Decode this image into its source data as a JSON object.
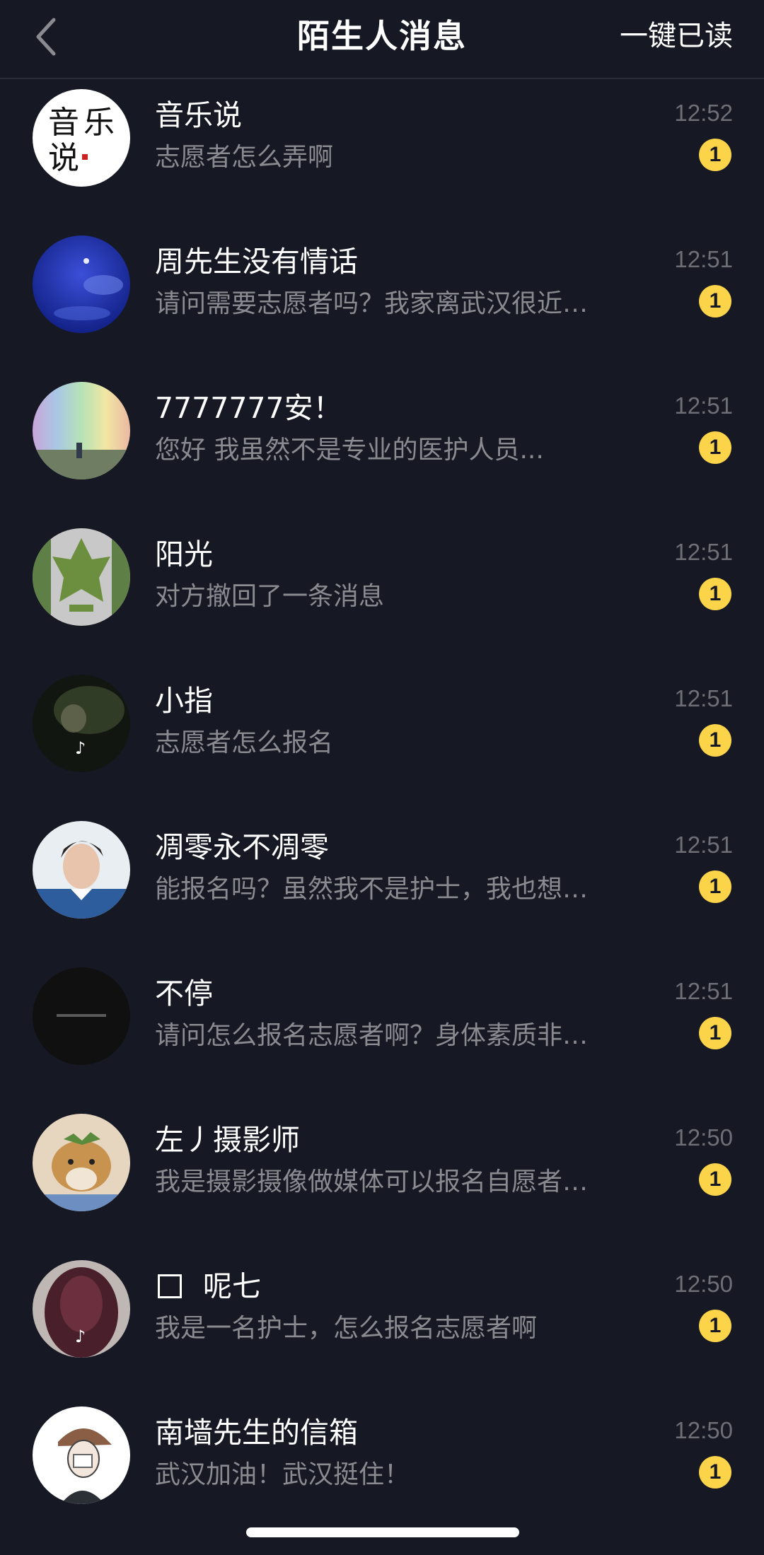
{
  "header": {
    "title": "陌生人消息",
    "mark_all_read": "一键已读",
    "back_icon": "chevron-left-icon"
  },
  "colors": {
    "background": "#161823",
    "badge": "#fbd449",
    "preview_text": "#8a8b91",
    "time_text": "#6e6f76"
  },
  "messages": [
    {
      "name": "音乐说",
      "preview": "志愿者怎么弄啊",
      "time": "12:52",
      "unread": "1"
    },
    {
      "name": "周先生没有情话",
      "preview": "请问需要志愿者吗？我家离武汉很近…",
      "time": "12:51",
      "unread": "1"
    },
    {
      "name": "7777777安！",
      "preview": "您好  我虽然不是专业的医护人员...",
      "time": "12:51",
      "unread": "1"
    },
    {
      "name": "阳光",
      "preview": "对方撤回了一条消息",
      "time": "12:51",
      "unread": "1"
    },
    {
      "name": "小指",
      "preview": "志愿者怎么报名",
      "time": "12:51",
      "unread": "1"
    },
    {
      "name": "凋零永不凋零",
      "preview": "能报名吗？虽然我不是护士，我也想…",
      "time": "12:51",
      "unread": "1"
    },
    {
      "name": "不停",
      "preview": "请问怎么报名志愿者啊？身体素质非…",
      "time": "12:51",
      "unread": "1"
    },
    {
      "name": "左丿摄影师",
      "preview": "我是摄影摄像做媒体可以报名自愿者…",
      "time": "12:50",
      "unread": "1"
    },
    {
      "name": "呢七",
      "preview": "我是一名护士，怎么报名志愿者啊",
      "time": "12:50",
      "unread": "1"
    },
    {
      "name": "南墙先生的信箱",
      "preview": "武汉加油！武汉挺住！",
      "time": "12:50",
      "unread": "1"
    }
  ]
}
